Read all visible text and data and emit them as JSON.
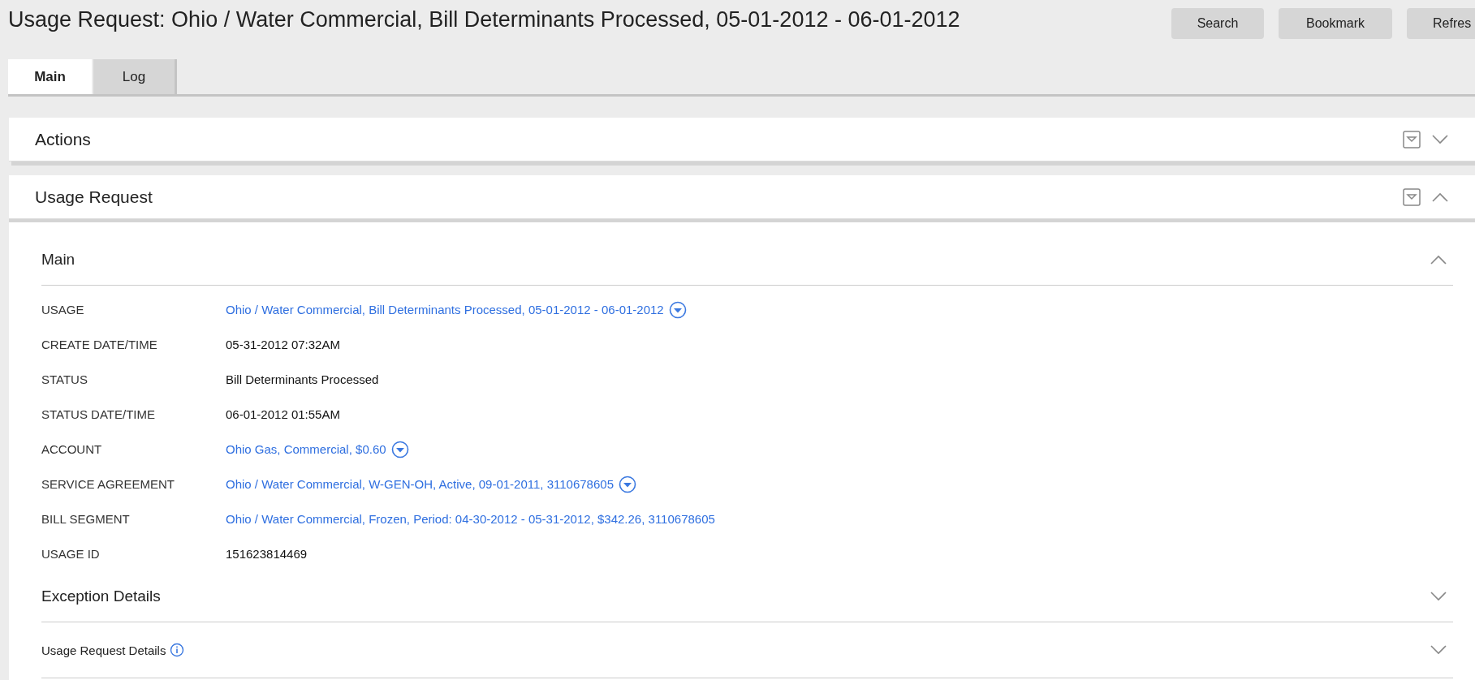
{
  "page_title": "Usage Request: Ohio / Water Commercial, Bill Determinants Processed, 05-01-2012 - 06-01-2012",
  "toolbar_buttons": [
    "Search",
    "Bookmark",
    "Refres"
  ],
  "tabs": [
    {
      "label": "Main",
      "selected": true
    },
    {
      "label": "Log",
      "selected": false
    }
  ],
  "panels": [
    {
      "title": "Actions",
      "expanded": false
    },
    {
      "title": "Usage Request",
      "expanded": true
    }
  ],
  "main_section": {
    "title": "Main",
    "expanded": true,
    "fields": [
      {
        "label": "USAGE",
        "value": "Ohio / Water Commercial, Bill Determinants Processed, 05-01-2012 - 06-01-2012",
        "kind": "link",
        "has_menu": true
      },
      {
        "label": "CREATE DATE/TIME",
        "value": "05-31-2012 07:32AM",
        "kind": "text",
        "has_menu": false
      },
      {
        "label": "STATUS",
        "value": "Bill Determinants Processed",
        "kind": "text",
        "has_menu": false
      },
      {
        "label": "STATUS DATE/TIME",
        "value": "06-01-2012 01:55AM",
        "kind": "text",
        "has_menu": false
      },
      {
        "label": "ACCOUNT",
        "value": "Ohio Gas, Commercial, $0.60",
        "kind": "link",
        "has_menu": true
      },
      {
        "label": "SERVICE AGREEMENT",
        "value": "Ohio / Water Commercial, W-GEN-OH, Active, 09-01-2011, 3110678605",
        "kind": "link",
        "has_menu": true
      },
      {
        "label": "BILL SEGMENT",
        "value": "Ohio / Water Commercial, Frozen, Period: 04-30-2012 - 05-31-2012, $342.26, 3110678605",
        "kind": "link",
        "has_menu": false
      },
      {
        "label": "USAGE ID",
        "value": "151623814469",
        "kind": "text",
        "has_menu": false
      }
    ]
  },
  "sub_sections": [
    {
      "title": "Exception Details",
      "kind": "heading",
      "expanded": false,
      "info": false
    },
    {
      "title": "Usage Request Details",
      "kind": "small",
      "expanded": false,
      "info": true
    }
  ]
}
